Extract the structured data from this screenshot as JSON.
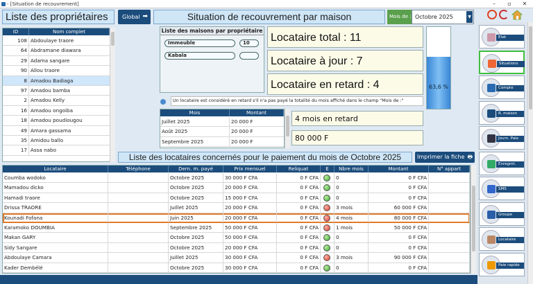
{
  "window": {
    "title": "- [Situation de recouvrement]",
    "min": "–",
    "max": "▫",
    "close": "✕"
  },
  "owners_panel": {
    "title": "Liste des propriétaires",
    "columns": [
      "ID",
      "Nom complet"
    ],
    "rows": [
      [
        "108",
        "Abdoulaye traore"
      ],
      [
        "64",
        "Abdramane diawara"
      ],
      [
        "29",
        "Adama sangare"
      ],
      [
        "90",
        "Allou traore"
      ],
      [
        "8",
        "Amadou Badiaga"
      ],
      [
        "97",
        "Amadou bamba"
      ],
      [
        "2",
        "Amadou Kelly"
      ],
      [
        "16",
        "Amadou ongoiba"
      ],
      [
        "18",
        "Amadou poudiougou"
      ],
      [
        "49",
        "Amara gassama"
      ],
      [
        "35",
        "Amidou ballo"
      ],
      [
        "17",
        "Assa nabo"
      ]
    ],
    "selected_row": 4
  },
  "global_button": {
    "label": "Global",
    "arrow": "➡"
  },
  "header": {
    "title": "Situation de recouvrement par maison",
    "month_label": "Mois de :",
    "month_value": "Octobre 2025"
  },
  "houses_panel": {
    "title": "Liste des maisons par propriétaire",
    "items": [
      {
        "name": "Immeuble",
        "count": "10"
      },
      {
        "name": "Kabala",
        "count": ""
      }
    ]
  },
  "stats": {
    "total": "Locataire total : 11",
    "a_jour": "Locataire à jour : 7",
    "en_retard": "Locataire en retard : 4",
    "gauge_text": "63,6 %",
    "gauge_fraction": 0.636
  },
  "info_note": "Un locataire est considéré en retard s'il n'a pas payé la totalité du mois affiché dans le champ \"Mois de :\"",
  "months_table": {
    "columns": [
      "Mois",
      "Montant"
    ],
    "rows": [
      [
        "Juillet 2025",
        "20 000 F"
      ],
      [
        "Août 2025",
        "20 000 F"
      ],
      [
        "Septembre 2025",
        "20 000 F"
      ]
    ]
  },
  "arrears": {
    "months": "4 mois en retard",
    "amount": "80 000 F"
  },
  "tenants_section": {
    "title": "Liste des locataires concernés pour le paiement du mois de Octobre 2025",
    "print_button": "Imprimer la fiche",
    "print_icon": "🖶",
    "columns": [
      "Locataire",
      "Téléphone",
      "Dern. m. payé",
      "Prix mensuel",
      "Reliquat",
      "E",
      "Nbre mois",
      "Montant",
      "N° appart"
    ],
    "rows": [
      {
        "name": "Coumba wodoko",
        "phone": "",
        "last": "Octobre 2025",
        "price": "30 000 F CFA",
        "rest": "0 F CFA",
        "status": "green",
        "months": "0",
        "amount": "0 F CFA",
        "apt": ""
      },
      {
        "name": "Mamadou dicko",
        "phone": "",
        "last": "Octobre 2025",
        "price": "20 000 F CFA",
        "rest": "0 F CFA",
        "status": "green",
        "months": "0",
        "amount": "0 F CFA",
        "apt": ""
      },
      {
        "name": "Hamadi traore",
        "phone": "",
        "last": "Octobre 2025",
        "price": "15 000 F CFA",
        "rest": "0 F CFA",
        "status": "green",
        "months": "0",
        "amount": "0 F CFA",
        "apt": ""
      },
      {
        "name": "Drissa TRAORE",
        "phone": "",
        "last": "Juillet 2025",
        "price": "20 000 F CFA",
        "rest": "0 F CFA",
        "status": "red",
        "months": "3 mois",
        "amount": "60 000 F CFA",
        "apt": ""
      },
      {
        "name": "Kounadi Fofana",
        "phone": "",
        "last": "Juin 2025",
        "price": "20 000 F CFA",
        "rest": "0 F CFA",
        "status": "red",
        "months": "4 mois",
        "amount": "80 000 F CFA",
        "apt": ""
      },
      {
        "name": "Karamoko DOUMBIA",
        "phone": "",
        "last": "Septembre 2025",
        "price": "50 000 F CFA",
        "rest": "0 F CFA",
        "status": "red",
        "months": "1 mois",
        "amount": "50 000 F CFA",
        "apt": ""
      },
      {
        "name": "Makan GARY",
        "phone": "",
        "last": "Octobre 2025",
        "price": "50 000 F CFA",
        "rest": "0 F CFA",
        "status": "green",
        "months": "0",
        "amount": "0 F CFA",
        "apt": ""
      },
      {
        "name": "Sidy Sangare",
        "phone": "",
        "last": "Octobre 2025",
        "price": "20 000 F CFA",
        "rest": "0 F CFA",
        "status": "green",
        "months": "0",
        "amount": "0 F CFA",
        "apt": ""
      },
      {
        "name": "Abdoulaye Camara",
        "phone": "",
        "last": "Juillet 2025",
        "price": "30 000 F CFA",
        "rest": "0 F CFA",
        "status": "red",
        "months": "3 mois",
        "amount": "90 000 F CFA",
        "apt": ""
      },
      {
        "name": "Kader Dembélé",
        "phone": "",
        "last": "Octobre 2025",
        "price": "30 000 F CFA",
        "rest": "0 F CFA",
        "status": "green",
        "months": "0",
        "amount": "0 F CFA",
        "apt": ""
      }
    ],
    "highlighted_row": 4
  },
  "sidebar": [
    {
      "label": "Etat",
      "icon": "person-icon"
    },
    {
      "label": "Situations",
      "icon": "pie-chart-icon"
    },
    {
      "label": "Compte",
      "icon": "book-icon"
    },
    {
      "label": "R. maison",
      "icon": "list-icon"
    },
    {
      "label": "Journ. Paie",
      "icon": "chart-icon"
    },
    {
      "label": "Enregmt.",
      "icon": "download-icon"
    },
    {
      "label": "SMS",
      "icon": "sms-icon"
    },
    {
      "label": "Groupe",
      "icon": "group-icon"
    },
    {
      "label": "Locataire",
      "icon": "people-icon"
    },
    {
      "label": "Paie rapide",
      "icon": "hand-icon"
    }
  ],
  "top_icons": [
    "power-icon",
    "refresh-icon",
    "home-icon"
  ],
  "colors": {
    "navy": "#1b4c7c",
    "highlight": "#e07a2a",
    "selected": "#cfe6fb"
  }
}
